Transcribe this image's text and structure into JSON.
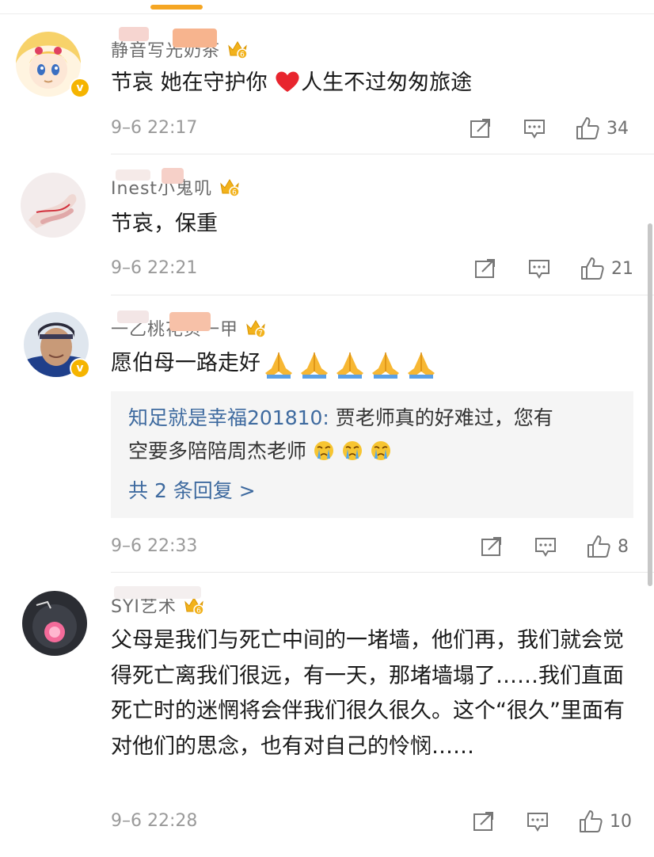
{
  "comments": [
    {
      "username": "静音写光奶茶",
      "text": "节哀 她在守护你",
      "text_after": "人生不过匆匆旅途",
      "time": "9–6 22:17",
      "likes": "34",
      "level": "6",
      "verified_icon": "v"
    },
    {
      "username": "Inest小鬼叽",
      "text": "节哀，保重",
      "time": "9–6 22:21",
      "likes": "21",
      "level": "6"
    },
    {
      "username": "一乙桃花页一甲",
      "text": "愿伯母一路走好",
      "time": "9–6 22:33",
      "likes": "8",
      "level": "7",
      "verified_icon": "v",
      "reply": {
        "user": "知足就是幸福201810:",
        "line1": " 贾老师真的好难过，您有",
        "line2": "空要多陪陪周杰老师",
        "more": "共 2 条回复 >"
      }
    },
    {
      "username": "SYI艺术",
      "text": "父母是我们与死亡中间的一堵墙，他们再，我们就会觉得死亡离我们很远，有一天，那堵墙塌了……我们直面死亡时的迷惘将会伴我们很久很久。这个“很久”里面有对他们的思念，也有对自己的怜悯……",
      "time": "9–6 22:28",
      "likes": "10",
      "level": "6"
    }
  ],
  "colors": {
    "accent": "#f5a623",
    "link": "#3e6a9f",
    "crown": "#f2b21c"
  },
  "icons": [
    "crown-icon",
    "repost-icon",
    "comment-icon",
    "like-icon",
    "heart-emoji",
    "pray-emoji",
    "crying-emoji",
    "verified-badge-icon"
  ]
}
